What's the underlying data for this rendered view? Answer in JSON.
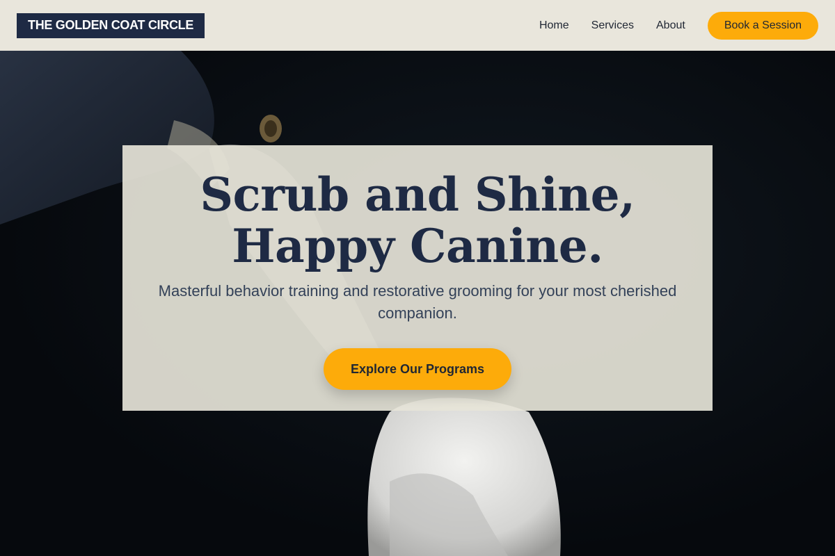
{
  "header": {
    "logo": "THE GOLDEN COAT CIRCLE",
    "nav": [
      "Home",
      "Services",
      "About"
    ],
    "cta": "Book a Session"
  },
  "hero": {
    "headline_line1": "Scrub and Shine,",
    "headline_line2": "Happy Canine.",
    "subtitle": "Masterful behavior training and restorative grooming for your most cherished companion.",
    "cta": "Explore Our Programs"
  },
  "colors": {
    "accent": "#fdab0a",
    "navy": "#1e2a44",
    "header_bg": "#e9e6dc",
    "card_bg": "#e6e4d8"
  },
  "icons": {
    "background_image": "dog-photo"
  }
}
